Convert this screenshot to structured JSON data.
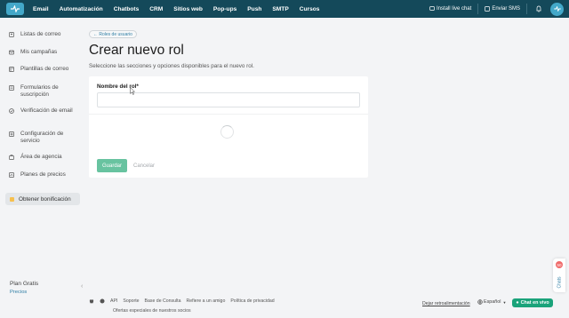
{
  "topbar": {
    "nav": [
      "Email",
      "Automatización",
      "Chatbots",
      "CRM",
      "Sitios web",
      "Pop-ups",
      "Push",
      "SMTP",
      "Cursos"
    ],
    "install_live_chat": "Install live chat",
    "send_sms": "Enviar SMS"
  },
  "sidebar": {
    "items": [
      {
        "label": "Listas de correo",
        "icon": "contacts-icon"
      },
      {
        "label": "Mis campañas",
        "icon": "campaigns-icon"
      },
      {
        "label": "Plantillas de correo",
        "icon": "template-icon"
      },
      {
        "label": "Formularios de suscripción",
        "icon": "form-icon"
      },
      {
        "label": "Verificación de email",
        "icon": "verify-icon"
      },
      {
        "label": "Configuración de servicio",
        "icon": "settings-icon"
      },
      {
        "label": "Área de agencia",
        "icon": "agency-icon"
      },
      {
        "label": "Planes de precios",
        "icon": "pricing-icon"
      }
    ],
    "bonus": "Obtener bonificación",
    "plan_name": "Plan Gratis",
    "plan_link": "Precios"
  },
  "main": {
    "breadcrumb": "← Roles de usuario",
    "title": "Crear nuevo rol",
    "subtitle": "Seleccione las secciones y opciones disponibles para el nuevo rol.",
    "field_label": "Nombre del rol*",
    "field_value": "",
    "save_label": "Guardar",
    "cancel_label": "Cancelar"
  },
  "footer": {
    "links": [
      "API",
      "Soporte",
      "Base de Consulta",
      "Refiere a un amigo",
      "Política de privacidad"
    ],
    "offers": "Ofertas especiales de nuestros socios",
    "feedback": "Dejar retroalimentación",
    "language": "Español",
    "chat": "Chat en vivo"
  },
  "chats_tab": {
    "badge": "50",
    "label": "Chats"
  },
  "colors": {
    "topbar": "#14495a",
    "accent": "#43a8c9",
    "save_button": "#68c3a0",
    "chat_button": "#1aa37a"
  }
}
